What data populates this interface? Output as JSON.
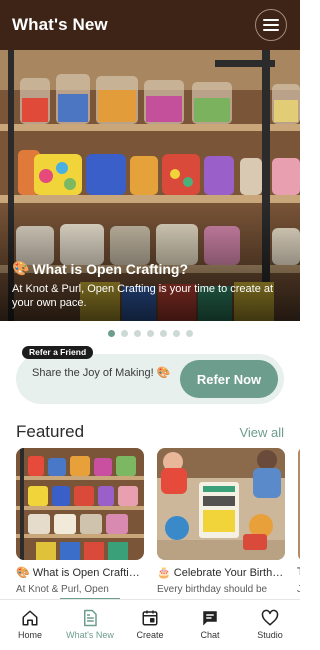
{
  "header": {
    "title": "What's New"
  },
  "hero": {
    "title_emoji": "🎨",
    "title": "What is Open Crafting?",
    "description": "At Knot & Purl, Open Crafting is your time to create at your own pace.",
    "page_count": 7,
    "active_page": 1
  },
  "refer": {
    "tag": "Refer a Friend",
    "text": "Share the Joy of Making! 🎨",
    "button": "Refer Now"
  },
  "featured": {
    "title": "Featured",
    "view_all": "View all",
    "cards": [
      {
        "title": "🎨 What is Open Crafti…",
        "subtitle": "At Knot & Purl, Open"
      },
      {
        "title": "🎂 Celebrate Your Birth…",
        "subtitle": "Every birthday should be"
      },
      {
        "title": "T",
        "subtitle": "J"
      }
    ]
  },
  "nav": {
    "items": [
      {
        "label": "Home",
        "icon": "home-icon"
      },
      {
        "label": "What's New",
        "icon": "document-icon"
      },
      {
        "label": "Create",
        "icon": "calendar-icon"
      },
      {
        "label": "Chat",
        "icon": "chat-icon"
      },
      {
        "label": "Studio",
        "icon": "heart-icon"
      }
    ],
    "active": "What's New"
  },
  "colors": {
    "header_bg": "#3d2417",
    "accent": "#6d9d8c",
    "refer_bg": "#e7f0ed"
  }
}
